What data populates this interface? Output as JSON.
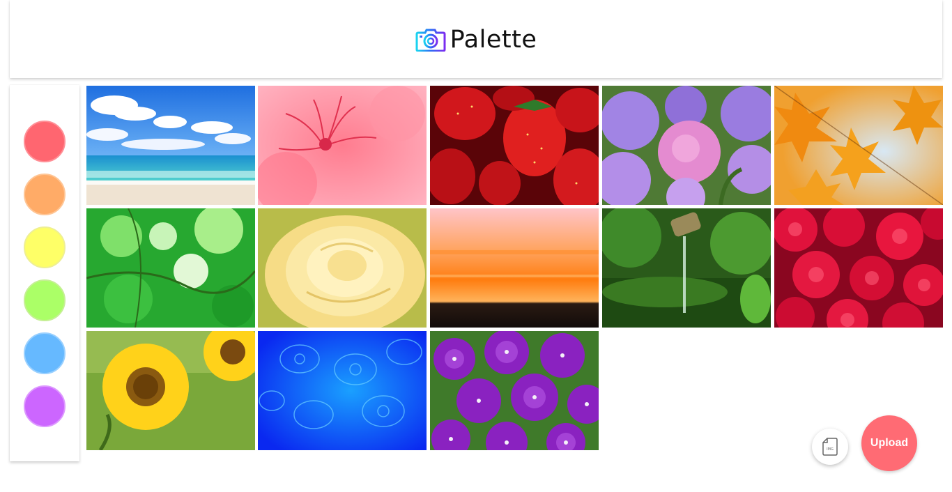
{
  "header": {
    "title": "Palette",
    "logo_icon": "camera-icon"
  },
  "sidebar": {
    "swatches": [
      {
        "name": "red",
        "fill": "#ff6670",
        "border": "#ff8f96"
      },
      {
        "name": "orange",
        "fill": "#ffab67",
        "border": "#ffc594"
      },
      {
        "name": "yellow",
        "fill": "#feff67",
        "border": "#eeef94"
      },
      {
        "name": "green",
        "fill": "#abff67",
        "border": "#c5ef94"
      },
      {
        "name": "blue",
        "fill": "#66b9ff",
        "border": "#99d0ff"
      },
      {
        "name": "purple",
        "fill": "#cc66ff",
        "border": "#dd99ff"
      }
    ]
  },
  "gallery": {
    "images": [
      {
        "subject": "beach",
        "colors": [
          "#2f7fe0",
          "#ffffff",
          "#3fbfc3",
          "#efe5d8"
        ]
      },
      {
        "subject": "pink-spider-lily",
        "colors": [
          "#ff7a8c",
          "#f0506a",
          "#ffb0bc"
        ]
      },
      {
        "subject": "strawberries",
        "colors": [
          "#c8141a",
          "#8a0a10",
          "#ff3b2f"
        ]
      },
      {
        "subject": "hydrangea",
        "colors": [
          "#a884e0",
          "#e48bd0",
          "#5f8a3c"
        ]
      },
      {
        "subject": "autumn-maple",
        "colors": [
          "#f29a1a",
          "#ffc76a",
          "#a9d2ea"
        ]
      },
      {
        "subject": "green-leaves",
        "colors": [
          "#29b532",
          "#7fe06a",
          "#e8f8e0"
        ]
      },
      {
        "subject": "yellow-rose",
        "colors": [
          "#fff0b0",
          "#f2d97a",
          "#b8c040"
        ]
      },
      {
        "subject": "orange-sunset",
        "colors": [
          "#ffc3c8",
          "#ff8a1a",
          "#1a1210"
        ]
      },
      {
        "subject": "bamboo-fountain",
        "colors": [
          "#2f6a1f",
          "#5fa83a",
          "#cfe9c8"
        ]
      },
      {
        "subject": "red-roses",
        "colors": [
          "#e8103a",
          "#a00828",
          "#ff5070"
        ]
      },
      {
        "subject": "sunflowers",
        "colors": [
          "#ffd21a",
          "#7a5a10",
          "#7aa83a"
        ]
      },
      {
        "subject": "jellyfish",
        "colors": [
          "#0a3cff",
          "#1a9cff",
          "#6ad0ff"
        ]
      },
      {
        "subject": "purple-clematis",
        "colors": [
          "#7a1ab0",
          "#a040d8",
          "#3f7a2a"
        ]
      }
    ]
  },
  "actions": {
    "img_icon": "image-file-icon",
    "img_label": "IMG",
    "upload_label": "Upload"
  }
}
